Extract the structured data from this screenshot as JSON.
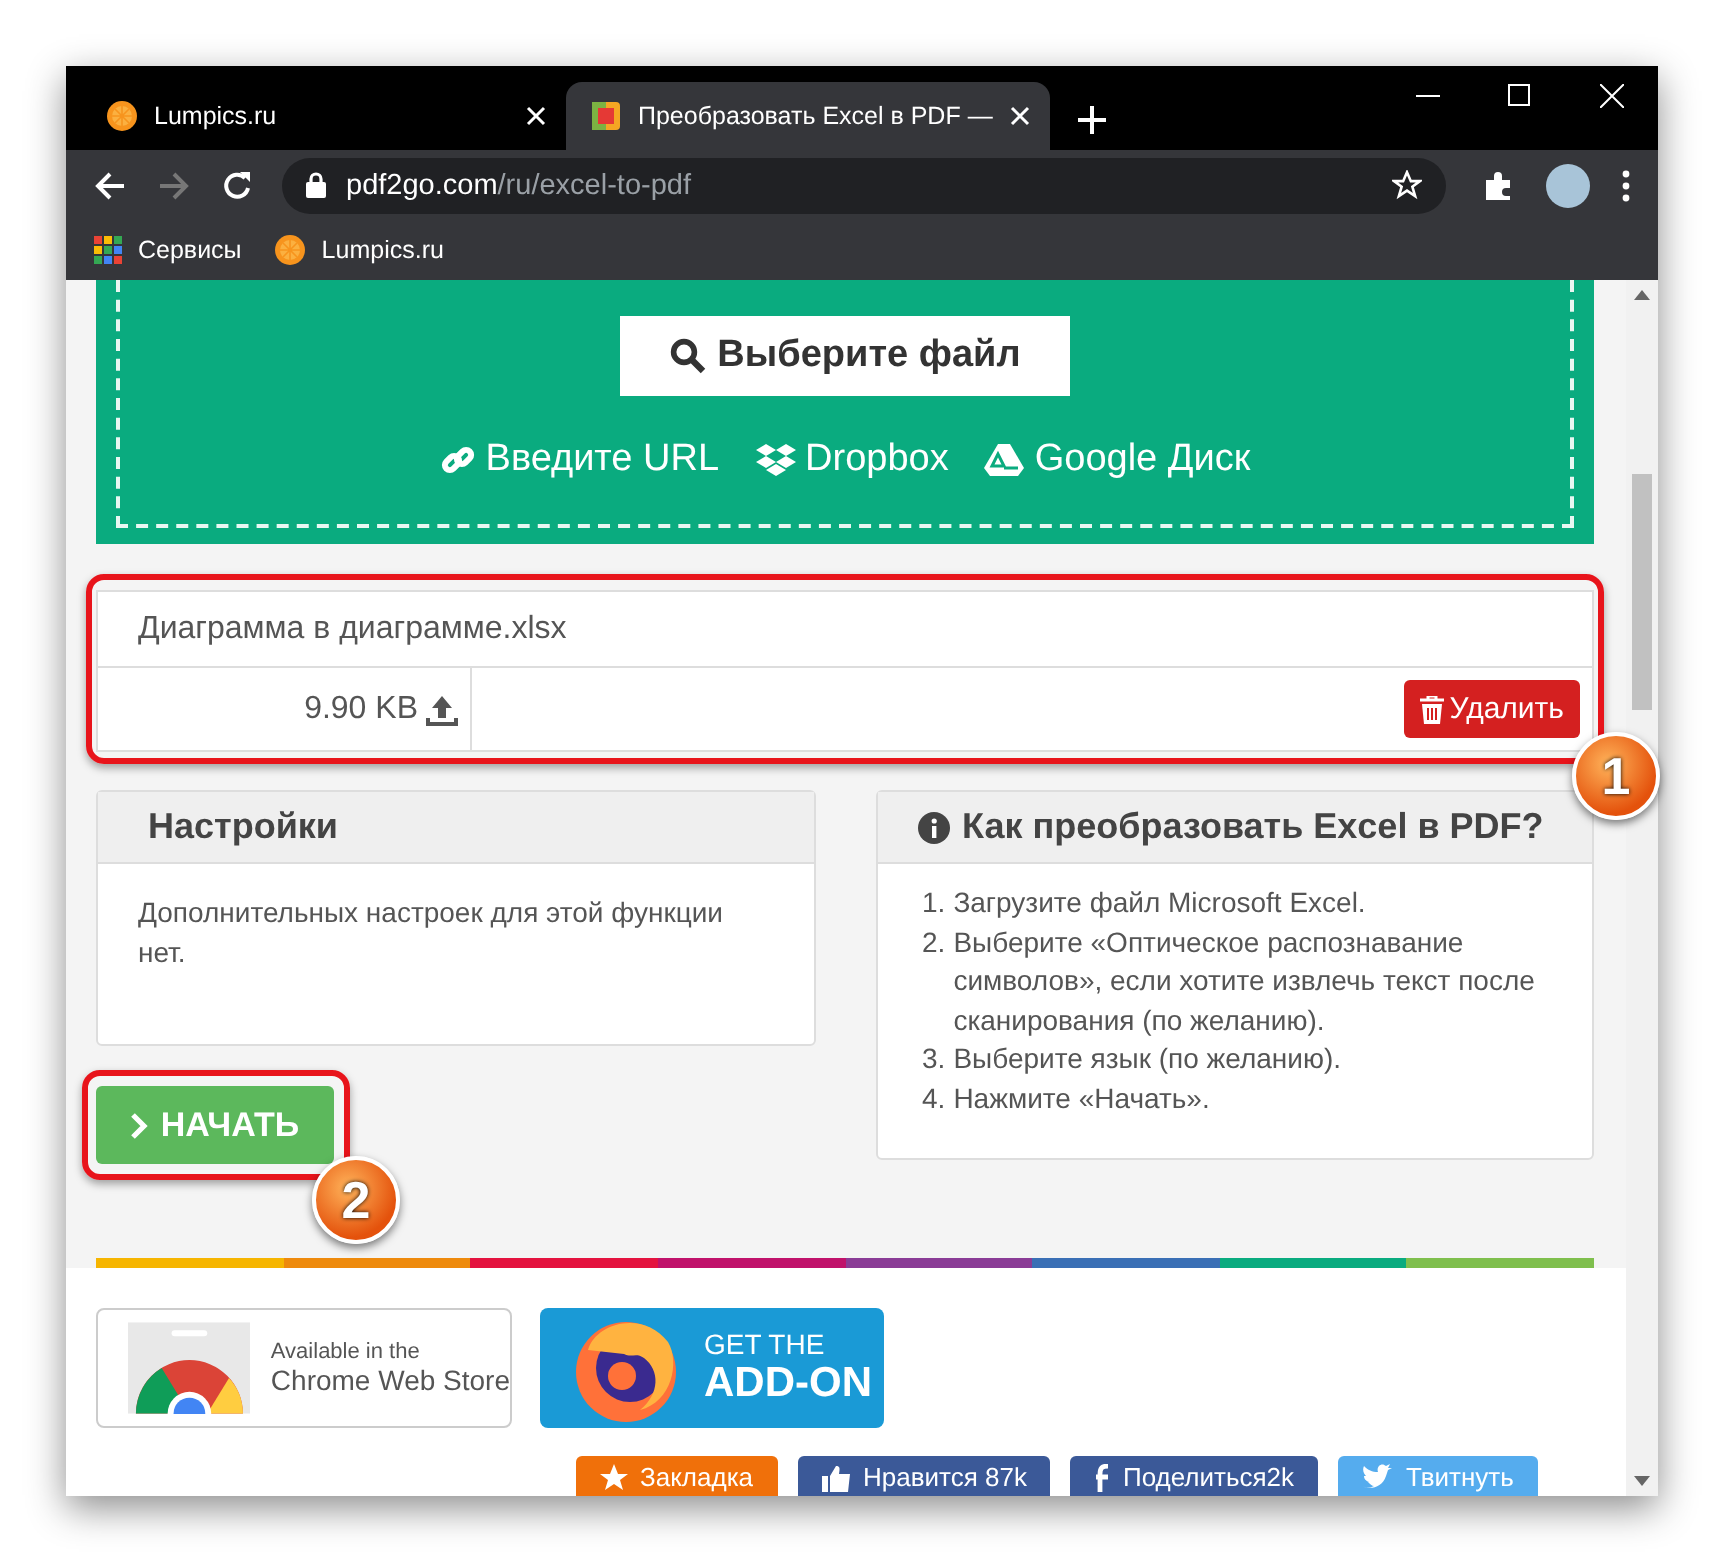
{
  "browser": {
    "tabs": [
      {
        "title": "Lumpics.ru",
        "kind": "lumpics",
        "selected": false
      },
      {
        "title": "Преобразовать Excel в PDF —",
        "kind": "converter",
        "selected": true
      }
    ],
    "address": {
      "host": "pdf2go.com",
      "path": "/ru/excel-to-pdf"
    },
    "bookmarks": [
      {
        "kind": "apps",
        "label": "Сервисы"
      },
      {
        "kind": "lumpics",
        "label": "Lumpics.ru"
      }
    ]
  },
  "upload": {
    "choose_button": "Выберите файл",
    "sources": [
      {
        "kind": "url",
        "label": "Введите URL"
      },
      {
        "kind": "dropbox",
        "label": "Dropbox"
      },
      {
        "kind": "drive",
        "label": "Google Диск"
      }
    ]
  },
  "file": {
    "name": "Диаграмма в диаграмме.xlsx",
    "size": "9.90 KB",
    "delete_button": "Удалить",
    "annotation": "1"
  },
  "settings": {
    "title": "Настройки",
    "text": "Дополнительных настроек для этой функции нет."
  },
  "start_button": {
    "label": "НАЧАТЬ",
    "annotation": "2"
  },
  "help": {
    "title": "Как преобразовать Excel в PDF?",
    "steps": [
      {
        "number": "1.",
        "text": "Загрузите файл Microsoft Excel."
      },
      {
        "number": "2.",
        "text": "Выберите «Оптическое распознавание символов», если хотите извлечь текст после сканирования (по желанию)."
      },
      {
        "number": "3.",
        "text": "Выберите язык (по желанию)."
      },
      {
        "number": "4.",
        "text": "Нажмите «Начать»."
      }
    ]
  },
  "store_badges": [
    {
      "kind": "chrome",
      "small": "Available in the",
      "large": "Chrome Web Store"
    },
    {
      "kind": "firefox",
      "small": "GET THE",
      "large": "ADD-ON"
    }
  ],
  "share_buttons": [
    {
      "kind": "bookmark",
      "label": "Закладка",
      "color": "#f0700a"
    },
    {
      "kind": "like",
      "label": "Нравится 87k",
      "color": "#3b5998"
    },
    {
      "kind": "facebook",
      "label": "Поделиться2k",
      "color": "#3b5998"
    },
    {
      "kind": "twitter",
      "label": "Твитнуть",
      "color": "#55acee"
    }
  ]
}
